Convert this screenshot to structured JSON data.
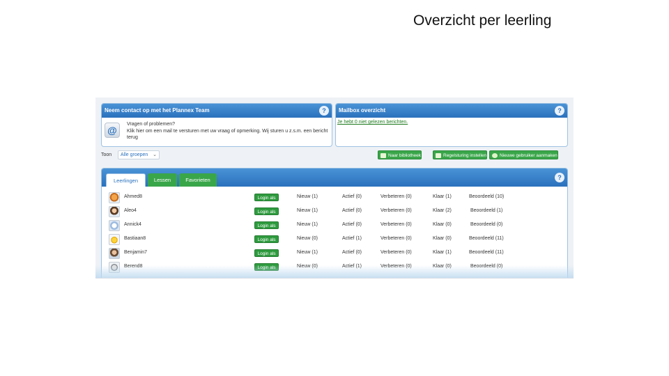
{
  "slide": {
    "title": "Overzicht per leerling"
  },
  "contact_panel": {
    "title": "Neem contact op met het Plannex Team",
    "icon": "at-icon",
    "heading": "Vragen of problemen?",
    "body": "Klik hier om een mail te versturen met uw vraag of opmerking. Wij sturen u z.s.m. een bericht terug"
  },
  "mailbox_panel": {
    "title": "Mailbox overzicht",
    "link": "Je hebt 0 niet gelezen berichten."
  },
  "filter": {
    "label": "Toon",
    "selected": "Alle groepen"
  },
  "actions": {
    "library": "Naar bibliotheek",
    "settings": "Regelsturing instellen",
    "new_user": "Nieuwe gebruiker aanmaken"
  },
  "tabs": [
    {
      "label": "Leerlingen",
      "active": true
    },
    {
      "label": "Lessen",
      "active": false
    },
    {
      "label": "Favorieten",
      "active": false
    }
  ],
  "students": {
    "login_label": "Login als",
    "rows": [
      {
        "avatar": "fox-avatar",
        "name": "Ahmed8",
        "nieuw": "Nieuw (1)",
        "actief": "Actief (0)",
        "verbeteren": "Verbeteren (0)",
        "klaar": "Klaar (1)",
        "beoordeeld": "Beoordeeld (10)"
      },
      {
        "avatar": "girl-avatar",
        "name": "Aleo4",
        "nieuw": "Nieuw (1)",
        "actief": "Actief (0)",
        "verbeteren": "Verbeteren (0)",
        "klaar": "Klaar (2)",
        "beoordeeld": "Beoordeeld (1)"
      },
      {
        "avatar": "ghost-avatar",
        "name": "Annick4",
        "nieuw": "Nieuw (1)",
        "actief": "Actief (0)",
        "verbeteren": "Verbeteren (0)",
        "klaar": "Klaar (0)",
        "beoordeeld": "Beoordeeld (0)"
      },
      {
        "avatar": "smiley-avatar",
        "name": "Bastiaan8",
        "nieuw": "Nieuw (0)",
        "actief": "Actief (1)",
        "verbeteren": "Verbeteren (0)",
        "klaar": "Klaar (0)",
        "beoordeeld": "Beoordeeld (11)"
      },
      {
        "avatar": "boy-avatar",
        "name": "Benjamin7",
        "nieuw": "Nieuw (1)",
        "actief": "Actief (0)",
        "verbeteren": "Verbeteren (0)",
        "klaar": "Klaar (1)",
        "beoordeeld": "Beoordeeld (11)"
      },
      {
        "avatar": "robot-avatar",
        "name": "Berend8",
        "nieuw": "Nieuw (0)",
        "actief": "Actief (1)",
        "verbeteren": "Verbeteren (0)",
        "klaar": "Klaar (0)",
        "beoordeeld": "Beoordeeld (0)"
      }
    ]
  }
}
